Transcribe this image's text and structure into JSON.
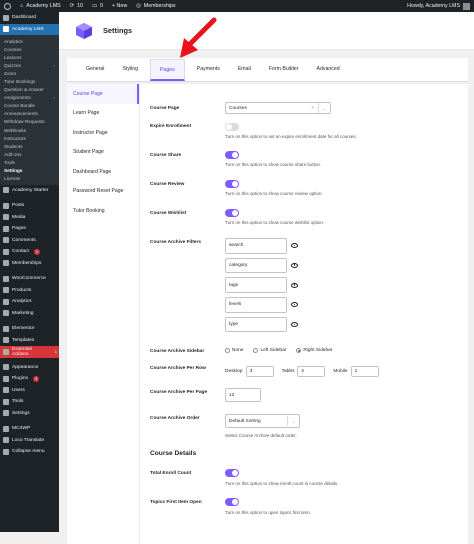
{
  "admin_bar": {
    "site_name": "Academy LMS",
    "updates": "10",
    "new_label": "+ New",
    "memberships": "Memberships",
    "greeting": "Howdy, Academy LMS"
  },
  "sidebar": {
    "dashboard": "Dashboard",
    "academy": "Academy LMS",
    "academy_items": [
      "Analytics",
      "Courses",
      "Lessons",
      "Quizzes",
      "Zoom",
      "Tutor Bookings",
      "Question & Answer",
      "Assignments",
      "Course Bundle",
      "Announcements",
      "Withdraw Requests",
      "Webhooks",
      "Instructors",
      "Students",
      "Add-ons",
      "Tools",
      "Settings",
      "License"
    ],
    "menu": [
      {
        "label": "Academy Starter",
        "icon": "academy-starter-icon"
      },
      {
        "label": "Posts",
        "icon": "pin-icon"
      },
      {
        "label": "Media",
        "icon": "media-icon"
      },
      {
        "label": "Pages",
        "icon": "pages-icon"
      },
      {
        "label": "Comments",
        "icon": "comments-icon"
      },
      {
        "label": "Contact",
        "icon": "mail-icon",
        "badge": "1"
      },
      {
        "label": "Memberships",
        "icon": "memberships-icon"
      },
      {
        "label": "WooCommerce",
        "icon": "woocommerce-icon"
      },
      {
        "label": "Products",
        "icon": "products-icon"
      },
      {
        "label": "Analytics",
        "icon": "analytics-icon"
      },
      {
        "label": "Marketing",
        "icon": "marketing-icon"
      },
      {
        "label": "Elementor",
        "icon": "elementor-icon"
      },
      {
        "label": "Templates",
        "icon": "templates-icon"
      },
      {
        "label": "Essential Addons",
        "icon": "essential-addons-icon",
        "badge": "1"
      },
      {
        "label": "Appearance",
        "icon": "appearance-icon"
      },
      {
        "label": "Plugins",
        "icon": "plugins-icon",
        "badge": "3"
      },
      {
        "label": "Users",
        "icon": "users-icon"
      },
      {
        "label": "Tools",
        "icon": "tools-icon"
      },
      {
        "label": "Settings",
        "icon": "settings-icon"
      },
      {
        "label": "MC4WP",
        "icon": "mc4wp-icon"
      },
      {
        "label": "Loco Translate",
        "icon": "translate-icon"
      },
      {
        "label": "Collapse menu",
        "icon": "collapse-icon"
      }
    ]
  },
  "header": {
    "title": "Settings"
  },
  "tabs": [
    "General",
    "Styling",
    "Pages",
    "Payments",
    "Email",
    "Form Builder",
    "Advanced"
  ],
  "subnav": [
    "Course Page",
    "Learn Page",
    "Instructor Page",
    "Student Page",
    "Dashboard Page",
    "Password Reset Page",
    "Tutor Booking"
  ],
  "form": {
    "course_page": {
      "label": "Course Page",
      "value": "Courses",
      "clear": "×",
      "caret": "⌄"
    },
    "expire_enrollment": {
      "label": "Expire Enrollment",
      "hint": "Turn on this option to set an expire enrollment date for all courses."
    },
    "course_share": {
      "label": "Course Share",
      "hint": "Turn on this option to show course share button."
    },
    "course_review": {
      "label": "Course Review",
      "hint": "Turn on this option to show course review option."
    },
    "course_wishlist": {
      "label": "Course Wishlist",
      "hint": "Turn on this option to show course wishlist option."
    },
    "archive_filters": {
      "label": "Course Archive Filters",
      "items": [
        "search",
        "category",
        "tags",
        "levels",
        "type"
      ]
    },
    "archive_sidebar": {
      "label": "Course Archive Sidebar",
      "options": [
        "None",
        "Left Sidebar",
        "Right Sidebar"
      ]
    },
    "archive_per_row": {
      "label": "Course Archive Per Row",
      "desktop_label": "Desktop",
      "desktop": "3",
      "tablet_label": "Tablet",
      "tablet": "2",
      "mobile_label": "Mobile",
      "mobile": "1"
    },
    "archive_per_page": {
      "label": "Course Archive Per Page",
      "value": "12"
    },
    "archive_order": {
      "label": "Course Archive Order",
      "value": "Default Sorting",
      "caret": "⌄",
      "hint": "Select Course Archive default order."
    },
    "details_heading": "Course Details",
    "total_enroll": {
      "label": "Total Enroll Count",
      "hint": "Turn on this option to show enroll count in course details."
    },
    "topics_first_open": {
      "label": "Topics First Item Open",
      "hint": "Turn on this option to open topics first item."
    }
  }
}
